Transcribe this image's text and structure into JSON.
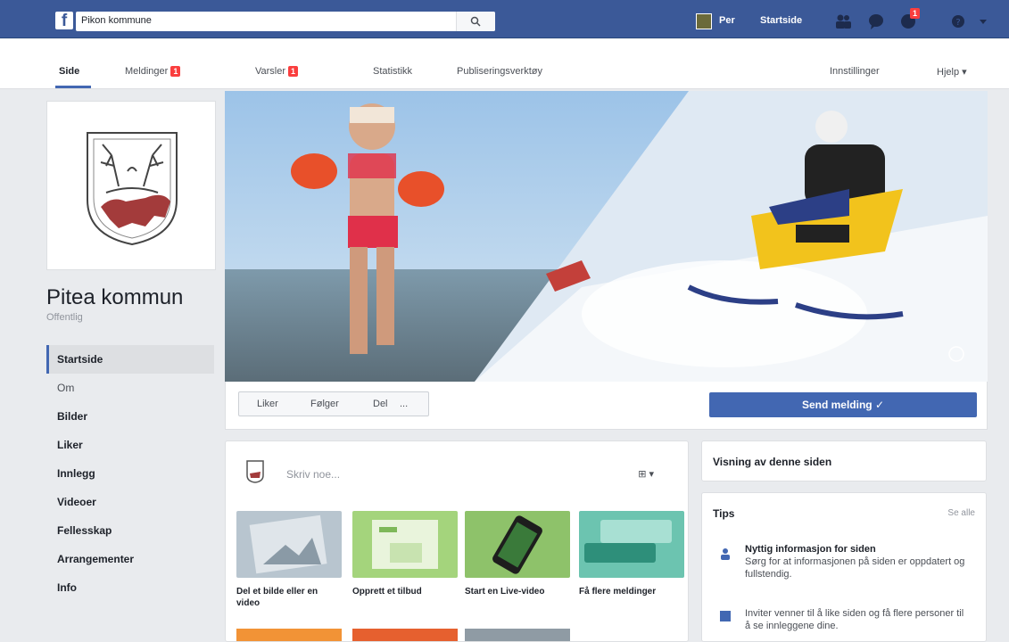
{
  "topbar": {
    "search_value": "Pikon kommune",
    "profile_name": "Per",
    "home_label": "Startside",
    "notif_count": "1"
  },
  "pagenav": {
    "items": [
      {
        "label": "Side",
        "badge": ""
      },
      {
        "label": "Meldinger",
        "badge": "1"
      },
      {
        "label": "Varsler",
        "badge": "1"
      },
      {
        "label": "Statistikk",
        "badge": ""
      },
      {
        "label": "Publiseringsverktøy",
        "badge": ""
      }
    ],
    "settings": "Innstillinger",
    "help": "Hjelp"
  },
  "page": {
    "name": "Pitea kommun",
    "category": "Offentlig"
  },
  "leftnav": [
    {
      "label": "Startside",
      "active": true,
      "plain": false
    },
    {
      "label": "Om",
      "active": false,
      "plain": true
    },
    {
      "label": "Bilder",
      "active": false,
      "plain": false
    },
    {
      "label": "Liker",
      "active": false,
      "plain": false
    },
    {
      "label": "Innlegg",
      "active": false,
      "plain": false
    },
    {
      "label": "Videoer",
      "active": false,
      "plain": false
    },
    {
      "label": "Fellesskap",
      "active": false,
      "plain": false
    },
    {
      "label": "Arrangementer",
      "active": false,
      "plain": false
    },
    {
      "label": "Info",
      "active": false,
      "plain": false
    }
  ],
  "actions": {
    "liked": "Liker",
    "following": "Følger",
    "share": "Del",
    "more": "...",
    "message": "Send melding"
  },
  "composer": {
    "prompt": "Skriv noe...",
    "dropdown": "▾",
    "tiles": [
      {
        "label": "Del et bilde eller en video",
        "color": "#b8c5cf"
      },
      {
        "label": "Opprett et tilbud",
        "color": "#a4d47c"
      },
      {
        "label": "Start en Live-video",
        "color": "#8ec26a"
      },
      {
        "label": "Få flere meldinger",
        "color": "#6cc4b0"
      }
    ]
  },
  "right": {
    "box1_title": "Visning av denne siden",
    "box2_title": "Tips",
    "see_all": "Se alle",
    "tips": [
      {
        "title": "Nyttig informasjon for siden",
        "text": "Sørg for at informasjonen på siden er oppdatert og fullstendig."
      },
      {
        "title": "",
        "text": "Inviter venner til å like siden og få flere personer til å se innleggene dine."
      }
    ]
  },
  "colors": {
    "brand": "#3b5998",
    "button": "#4267b2",
    "badge": "#fa3e3e"
  }
}
